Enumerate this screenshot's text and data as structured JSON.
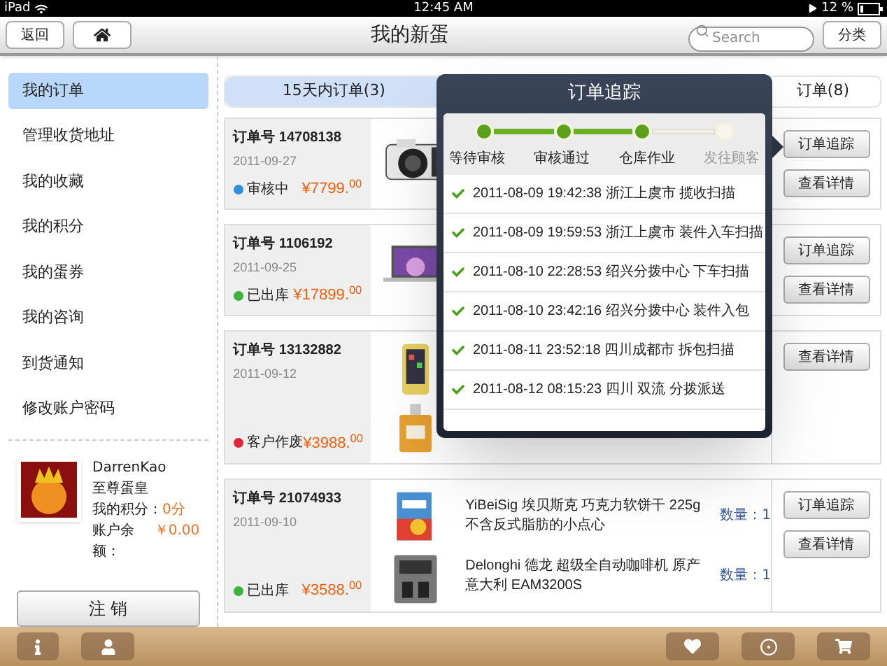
{
  "status_bar": {
    "device": "iPad",
    "time": "12:45 AM",
    "battery": "12 %"
  },
  "nav": {
    "back": "返回",
    "title": "我的新蛋",
    "search": {
      "placeholder": "Search"
    },
    "category": "分类"
  },
  "sidebar": {
    "items": [
      {
        "label": "我的订单",
        "selected": true
      },
      {
        "label": "管理收货地址",
        "selected": false
      },
      {
        "label": "我的收藏",
        "selected": false
      },
      {
        "label": "我的积分",
        "selected": false
      },
      {
        "label": "我的蛋券",
        "selected": false
      },
      {
        "label": "我的咨询",
        "selected": false
      },
      {
        "label": "到货通知",
        "selected": false
      },
      {
        "label": "修改账户密码",
        "selected": false
      }
    ],
    "user": {
      "name": "DarrenKao",
      "level": "至尊蛋皇",
      "points_label": "我的积分：",
      "points": "0分",
      "balance_label": "账户余额：",
      "balance": "￥0.00"
    },
    "logout": "注 销"
  },
  "tabs": [
    {
      "label": "15天内订单(3)",
      "selected": true
    },
    {
      "label": "订单(8)",
      "selected": false
    }
  ],
  "orders": [
    {
      "number": "订单号 14708138",
      "date": "2011-09-27",
      "status": "审核中",
      "color": "#2e8fdc",
      "price": "¥7799.$^{00}$",
      "items": [
        {
          "kind": "picture"
        }
      ],
      "buttons": [
        "订单追踪",
        "查看详情"
      ]
    },
    {
      "number": "订单号 1106192",
      "date": "2011-09-25",
      "status": "已出库",
      "color": "#3cb43c",
      "price": "¥17899.$^{00}$",
      "items": [
        {
          "kind": "picture"
        }
      ],
      "buttons": [
        "订单追踪",
        "查看详情"
      ]
    },
    {
      "number": "订单号 13132882",
      "date": "2011-09-12",
      "status": "客户作废",
      "color": "#e0283c",
      "price": "¥3988.$^{00}$",
      "items": [
        {
          "kind": "picture"
        },
        {
          "kind": "picture"
        }
      ],
      "buttons": [
        "查看详情"
      ]
    },
    {
      "number": "订单号 21074933",
      "date": "2011-09-10",
      "status": "已出库",
      "color": "#3cb43c",
      "price": "¥3588.$^{00}$",
      "items": [
        {
          "kind": "product",
          "name": "YiBeiSig 埃贝斯克 巧克力软饼干 225g 不含反式脂肪的小点心",
          "quantity": "数量：1"
        },
        {
          "kind": "product",
          "name": "Delonghi 德龙 超级全自动咖啡机 原产意大利 EAM3200S",
          "quantity": "数量：1"
        }
      ],
      "buttons": [
        "订单追踪",
        "查看详情"
      ]
    }
  ],
  "tracking": {
    "title": "订单追踪",
    "steps": [
      {
        "label": "等待审核",
        "done": true
      },
      {
        "label": "审核通过",
        "done": true
      },
      {
        "label": "仓库作业",
        "done": true
      },
      {
        "label": "发往顾客",
        "done": false
      }
    ],
    "events": [
      "2011-08-09 19:42:38 浙江上虞市 揽收扫描",
      "2011-08-09 19:59:53 浙江上虞市 装件入车扫描",
      "2011-08-10 22:28:53 绍兴分拨中心 下车扫描",
      "2011-08-10 23:42:16 绍兴分拨中心 装件入包",
      "2011-08-11 23:52:18 四川成都市 拆包扫描",
      "2011-08-12 08:15:23 四川 双流 分拨派送"
    ]
  }
}
